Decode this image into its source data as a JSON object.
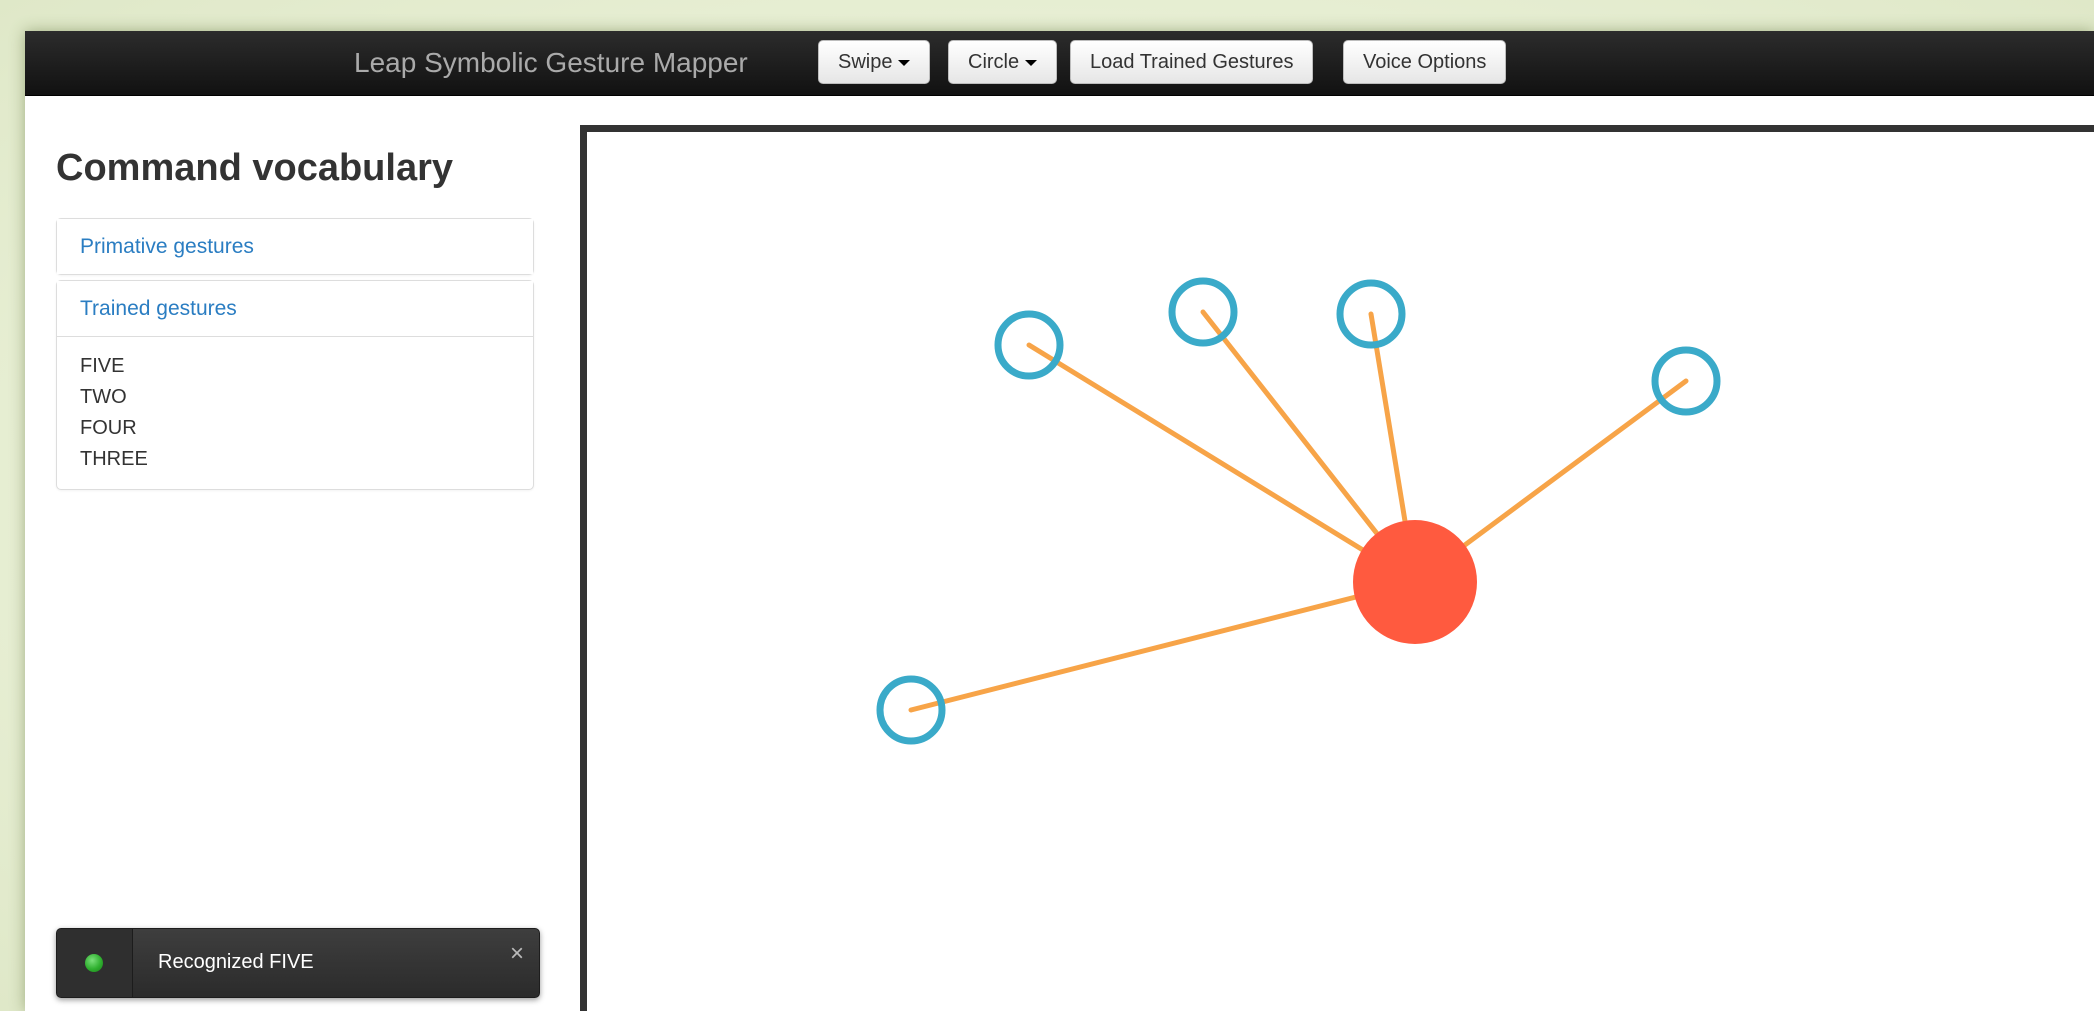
{
  "navbar": {
    "brand": "Leap Symbolic Gesture Mapper",
    "buttons": {
      "swipe": "Swipe",
      "circle": "Circle",
      "load": "Load Trained Gestures",
      "voice": "Voice Options"
    }
  },
  "sidebar": {
    "title": "Command vocabulary",
    "primitive_label": "Primative gestures",
    "trained_label": "Trained gestures",
    "trained_items": [
      "FIVE",
      "TWO",
      "FOUR",
      "THREE"
    ]
  },
  "visualization": {
    "palm_color": "#ff5a3f",
    "finger_ring_color": "#3aaac9",
    "bone_line_color": "#f7a448"
  },
  "notification": {
    "status_color": "#2fb02f",
    "message": "Recognized FIVE",
    "close_symbol": "×"
  }
}
